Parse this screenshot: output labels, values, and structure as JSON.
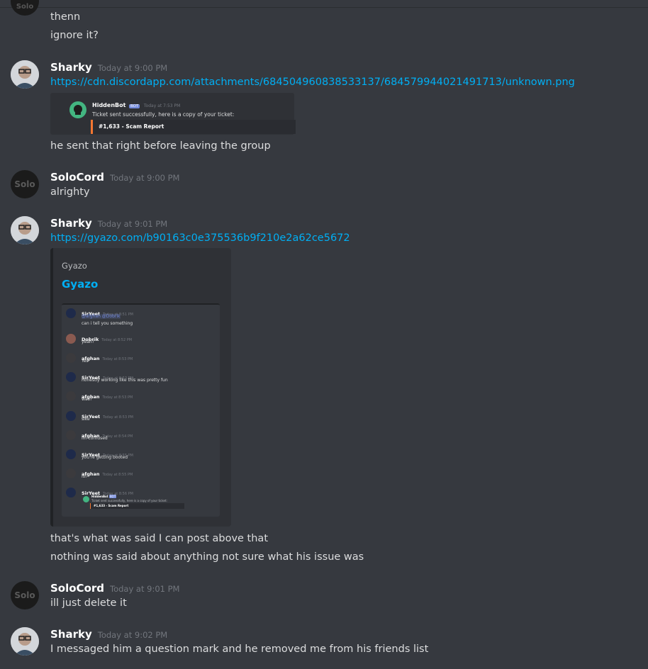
{
  "users": {
    "sharky": "Sharky",
    "solocord": "SoloCord"
  },
  "messages": {
    "prev1": "thenn",
    "prev2": "ignore it?",
    "g1_ts": "Today at 9:00 PM",
    "g1_link": "https://cdn.discordapp.com/attachments/684504960838533137/684579944021491713/unknown.png",
    "g1_text": "he sent that right before leaving the group",
    "g2_ts": "Today at 9:00 PM",
    "g2_text": "alrighty",
    "g3_ts": "Today at 9:01 PM",
    "g3_link": "https://gyazo.com/b90163c0e375536b9f210e2a62ce5672",
    "g3_text1": "that's what was said I can post above that",
    "g3_text2": "nothing was said about anything not sure what his issue was",
    "g4_ts": "Today at 9:01 PM",
    "g4_text": "ill just delete it",
    "g5_ts": "Today at 9:02 PM",
    "g5_text": "I messaged him a question mark and he removed me from his friends list"
  },
  "avatar_text": {
    "solo": "Solo"
  },
  "attachment": {
    "bot_name": "HiddenBot",
    "bot_tag": "BOT",
    "bot_ts": "Today at 7:53 PM",
    "bot_text": "Ticket sent successfully, here is a copy of your ticket:",
    "ticket_title": "#1,633 - Scam Report"
  },
  "embed": {
    "provider": "Gyazo",
    "title": "Gyazo"
  },
  "gyazo_shot": {
    "rows": [
      {
        "name": "SirYeet",
        "ts": "Today at 8:51 PM",
        "text": "can i tell you something",
        "mention": "@afghan @Dobrik"
      },
      {
        "name": "Dobrik",
        "ts": "Today at 8:52 PM",
        "text": "yeah?"
      },
      {
        "name": "afghan",
        "ts": "Today at 8:53 PM",
        "text": "Yes"
      },
      {
        "name": "SirYeet",
        "ts": "Today at 8:53 PM",
        "text": "honestly working like this was pretty fun"
      },
      {
        "name": "afghan",
        "ts": "Today at 8:53 PM",
        "text": "was?"
      },
      {
        "name": "SirYeet",
        "ts": "Today at 8:53 PM",
        "text": "sike"
      },
      {
        "name": "afghan",
        "ts": "Today at 8:54 PM",
        "text": "im confused"
      },
      {
        "name": "SirYeet",
        "ts": "Today at 8:55 PM",
        "text": "you're getting booted"
      },
      {
        "name": "afghan",
        "ts": "Today at 8:55 PM",
        "text": "lol"
      },
      {
        "name": "SirYeet",
        "ts": "Today at 8:56 PM",
        "text": ""
      }
    ],
    "bot_name": "HiddenBot",
    "bot_tag": "BOT",
    "bot_text": "Ticket sent successfully, here is a copy of your ticket:",
    "ticket": "#1,633 - Scam Report"
  },
  "colors": {
    "background": "#36393f",
    "link": "#00aff4",
    "ticket_accent": "#f57731",
    "bot_tag": "#7289da",
    "bot_avatar": "#43b581"
  }
}
